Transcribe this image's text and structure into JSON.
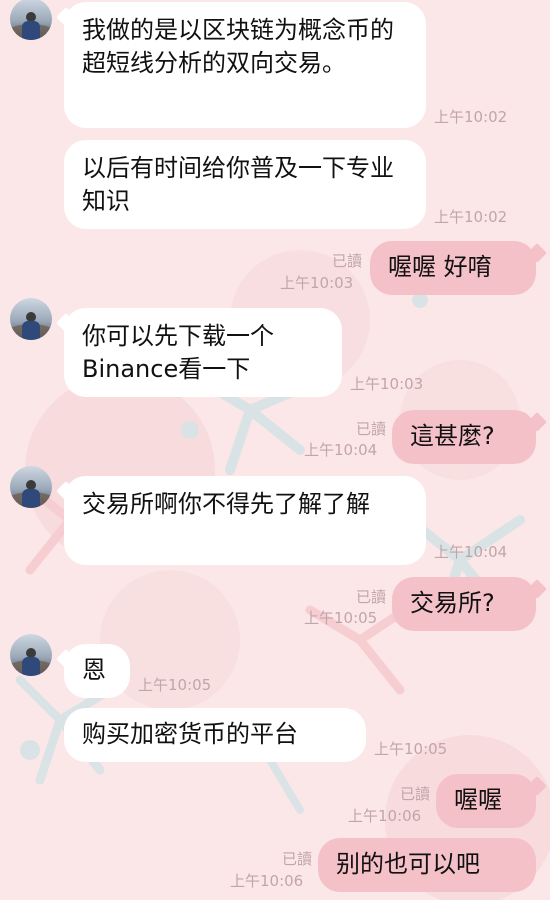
{
  "chat": {
    "messages": [
      {
        "id": "m1",
        "text": "我做的是以区块链为概念币的超短线分析的双向交易。",
        "time": "上午10:02"
      },
      {
        "id": "m2",
        "text": "以后有时间给你普及一下专业知识",
        "time": "上午10:02"
      },
      {
        "id": "m3",
        "text": "喔喔 好唷",
        "time": "上午10:03",
        "read": "已讀"
      },
      {
        "id": "m4",
        "text": "你可以先下载一个Binance看一下",
        "time": "上午10:03"
      },
      {
        "id": "m5",
        "text": "這甚麼?",
        "time": "上午10:04",
        "read": "已讀"
      },
      {
        "id": "m6",
        "text": "交易所啊你不得先了解了解",
        "time": "上午10:04"
      },
      {
        "id": "m7",
        "text": "交易所?",
        "time": "上午10:05",
        "read": "已讀"
      },
      {
        "id": "m8",
        "text": "恩",
        "time": "上午10:05"
      },
      {
        "id": "m9",
        "text": "购买加密货币的平台",
        "time": "上午10:05"
      },
      {
        "id": "m10",
        "text": "喔喔",
        "time": "上午10:06",
        "read": "已讀"
      },
      {
        "id": "m11",
        "text": "别的也可以吧",
        "time": "上午10:06",
        "read": "已讀"
      }
    ]
  },
  "colors": {
    "background": "#fbe7e8",
    "incoming_bubble": "#ffffff",
    "outgoing_bubble": "#f5c1c8",
    "meta_text": "#c2a5a9"
  }
}
